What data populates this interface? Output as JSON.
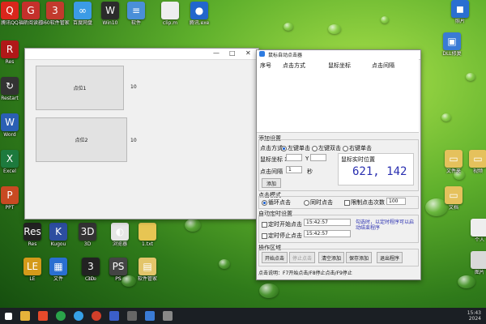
{
  "desktop": {
    "icons": [
      {
        "label": "腾讯QQ",
        "icon": "qq-icon",
        "color": "#d9261c",
        "glyph": "Q"
      },
      {
        "label": "福昕阅读器",
        "icon": "reader-icon",
        "color": "#c4302b",
        "glyph": "G"
      },
      {
        "label": "360软件管家",
        "icon": "app-store-icon",
        "color": "#c23a2d",
        "glyph": "3"
      },
      {
        "label": "百度网盘",
        "icon": "cloud-disk-icon",
        "color": "#3b9be6",
        "glyph": "∞"
      },
      {
        "label": "Win10",
        "icon": "window-icon",
        "color": "#2b2b2b",
        "glyph": "W"
      },
      {
        "label": "软件",
        "icon": "folder-icon",
        "color": "#4a8fd8",
        "glyph": "≡"
      },
      {
        "label": "clip.m",
        "icon": "file-icon",
        "color": "#eeeeee",
        "glyph": ""
      },
      {
        "label": "腾讯.exe",
        "icon": "ball-icon",
        "color": "#2266cc",
        "glyph": "●"
      },
      {
        "label": "DLL修复",
        "icon": "dll-icon",
        "color": "#3a7bd5",
        "glyph": "▣"
      },
      {
        "label": "照片",
        "icon": "photo-icon",
        "color": "#2a6fd1",
        "glyph": "◼"
      },
      {
        "label": "Res",
        "icon": "res-icon",
        "color": "#b01818",
        "glyph": "R"
      },
      {
        "label": "Restart",
        "icon": "restart-icon",
        "color": "#333",
        "glyph": "↻"
      },
      {
        "label": "Word",
        "icon": "word-icon",
        "color": "#2b5fb4",
        "glyph": "W"
      },
      {
        "label": "Excel",
        "icon": "excel-icon",
        "color": "#1d7a3d",
        "glyph": "X"
      },
      {
        "label": "PPT",
        "icon": "ppt-icon",
        "color": "#c84a22",
        "glyph": "P"
      },
      {
        "label": "3D",
        "icon": "3d-icon",
        "color": "#333",
        "glyph": "3D"
      },
      {
        "label": "1.txt",
        "icon": "text-file-icon",
        "color": "#e7c553",
        "glyph": ""
      },
      {
        "label": "Res",
        "icon": "res2-icon",
        "color": "#222",
        "glyph": "Res"
      },
      {
        "label": "Kugou",
        "icon": "music-icon",
        "color": "#2d4ea0",
        "glyph": "K"
      },
      {
        "label": "Core",
        "icon": "core-icon",
        "color": "#1a3f9a",
        "glyph": "●"
      },
      {
        "label": "浏览器",
        "icon": "browser-icon",
        "color": "#e6e6e6",
        "glyph": "◐"
      },
      {
        "label": "软件管家",
        "icon": "manager-icon",
        "color": "#e3c56a",
        "glyph": "▤"
      },
      {
        "label": "PS",
        "icon": "ps-icon",
        "color": "#1b3a66",
        "glyph": "Ps"
      },
      {
        "label": "LE",
        "icon": "le-icon",
        "color": "#d49a1a",
        "glyph": "LE"
      },
      {
        "label": "文件",
        "icon": "file2-icon",
        "color": "#2a6fd1",
        "glyph": "▦"
      },
      {
        "label": "3D",
        "icon": "3dmax-icon",
        "color": "#222",
        "glyph": "3"
      },
      {
        "label": "PS",
        "icon": "ps2-icon",
        "color": "#444",
        "glyph": "PS"
      },
      {
        "label": "文件夹",
        "icon": "folder2-icon",
        "color": "#e5c15c",
        "glyph": "▭"
      },
      {
        "label": "视频",
        "icon": "video-icon",
        "color": "#e5c15c",
        "glyph": "▭"
      },
      {
        "label": "文档",
        "icon": "doc-icon",
        "color": "#e5c15c",
        "glyph": "▭"
      },
      {
        "label": "个人",
        "icon": "person-icon",
        "color": "#eee",
        "glyph": ""
      },
      {
        "label": "图片",
        "icon": "picture-icon",
        "color": "#d9d9d9",
        "glyph": ""
      }
    ]
  },
  "win1": {
    "point1_label": "点位1",
    "point1_num": "10",
    "point2_label": "点位2",
    "point2_num": "10",
    "minimize": "—",
    "maximize": "□",
    "close": "✕"
  },
  "win2": {
    "title": "鼠标自动点击器",
    "col_headers": [
      "序号",
      "点击方式",
      "鼠标坐标",
      "点击间隔"
    ],
    "add_section": "添加设置",
    "click_mode_label": "点击方式",
    "mode_left": "左键单击",
    "mode_double": "左键双击",
    "mode_right": "右键单击",
    "coord_label": "鼠标坐标 X",
    "coord_y": "Y",
    "interval_label": "点击间隔",
    "interval_value": "1",
    "interval_unit": "秒",
    "add_btn": "添加",
    "live_label": "鼠标实时位置",
    "live_value": "621, 142",
    "loop_section": "点击模式",
    "loop_mode": "循环点击",
    "once_mode": "同时点击",
    "count_mode": "限制点击次数",
    "count_value": "100",
    "timer_section": "自动定时设置",
    "start_timer": "定时开始点击",
    "start_time": "15:42:57",
    "stop_timer": "定时停止点击",
    "stop_time": "15:42:57",
    "hint": "勾选时，以定时程序可以启动结束程序",
    "ops_section": "操作区域",
    "btn_start": "开始点击",
    "btn_stop": "停止点击",
    "btn_clear": "清空添加",
    "btn_save": "保存添加",
    "btn_exit": "退出程序",
    "footer": "点击说明：F7开始点击/F8停止点击/F9停止"
  },
  "taskbar": {
    "time": "15:43",
    "date": "2024"
  }
}
